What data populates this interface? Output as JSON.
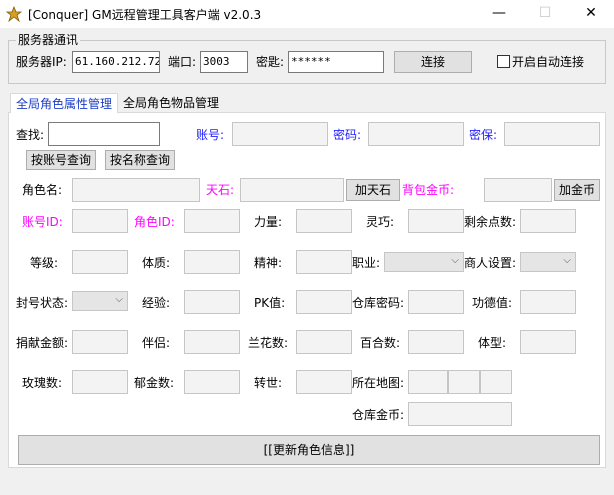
{
  "window": {
    "title": "[Conquer] GM远程管理工具客户端 v2.0.3",
    "icon": "app-icon",
    "minimize": "—",
    "maximize": "☐",
    "close": "✕"
  },
  "server": {
    "group_title": "服务器通讯",
    "ip_label": "服务器IP:",
    "ip_value": "61.160.212.72",
    "port_label": "端口:",
    "port_value": "3003",
    "key_label": "密匙:",
    "key_value": "******",
    "connect_label": "连接",
    "auto_connect_label": "开启自动连接"
  },
  "tabs": [
    {
      "label": "全局角色属性管理"
    },
    {
      "label": "全局角色物品管理"
    }
  ],
  "search": {
    "find_label": "查找:",
    "account_label": "账号:",
    "password_label": "密码:",
    "security_label": "密保:",
    "by_account_btn": "按账号查询",
    "by_name_btn": "按名称查询"
  },
  "fields": {
    "role_name": "角色名:",
    "tianshi": "天石:",
    "add_tianshi_btn": "加天石",
    "bag_gold": "背包金币:",
    "add_gold_btn": "加金币",
    "account_id": "账号ID:",
    "role_id": "角色ID:",
    "strength": "力量:",
    "agility": "灵巧:",
    "remaining_points": "剩余点数:",
    "level": "等级:",
    "physique": "体质:",
    "spirit": "精神:",
    "profession": "职业:",
    "merchant": "商人设置:",
    "ban_status": "封号状态:",
    "experience": "经验:",
    "pk": "PK值:",
    "warehouse_pwd": "仓库密码:",
    "merit": "功德值:",
    "donation": "捐献金额:",
    "partner": "伴侣:",
    "orchid": "兰花数:",
    "lily": "百合数:",
    "body_type": "体型:",
    "rose": "玫瑰数:",
    "tulip": "郁金数:",
    "rebirth": "转世:",
    "map": "所在地图:",
    "warehouse_gold": "仓库金币:"
  },
  "update_btn": "[[更新角色信息]]"
}
